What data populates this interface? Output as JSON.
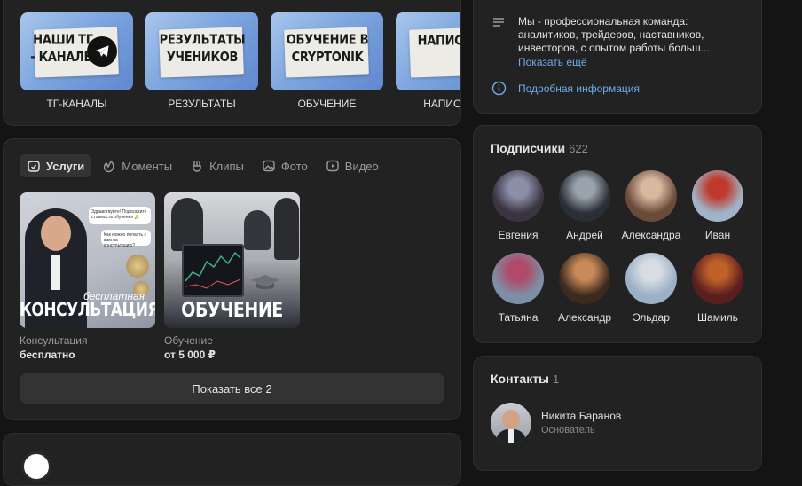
{
  "albums": [
    {
      "cover_text": "НАШИ ТГ - КАНАЛЫ",
      "caption": "ТГ-КАНАЛЫ",
      "has_tg_icon": true
    },
    {
      "cover_text": "РЕЗУЛЬТАТЫ УЧЕНИКОВ",
      "caption": "РЕЗУЛЬТАТЫ",
      "has_tg_icon": false
    },
    {
      "cover_text": "ОБУЧЕНИЕ В CRYPTONIK",
      "caption": "ОБУЧЕНИЕ",
      "has_tg_icon": false
    },
    {
      "cover_text": "НАПИСАТЬ",
      "caption": "НАПИСАТЬ",
      "has_tg_icon": false
    }
  ],
  "tabs": [
    {
      "label": "Услуги",
      "icon": "services-icon",
      "active": true
    },
    {
      "label": "Моменты",
      "icon": "moments-icon",
      "active": false
    },
    {
      "label": "Клипы",
      "icon": "clips-icon",
      "active": false
    },
    {
      "label": "Фото",
      "icon": "photo-icon",
      "active": false
    },
    {
      "label": "Видео",
      "icon": "video-icon",
      "active": false
    }
  ],
  "services": [
    {
      "title": "Консультация",
      "price": "бесплатно",
      "cover_script": "бесплатная",
      "cover_big": "КОНСУЛЬТАЦИЯ",
      "bubble1": "Здравствуйте! Подскажите стоимость обучения 🙏",
      "bubble2": "Как можно попасть к вам на консультацию?"
    },
    {
      "title": "Обучение",
      "price": "от 5 000 ₽",
      "cover_big": "ОБУЧЕНИЕ"
    }
  ],
  "show_all_label": "Показать все 2",
  "about": {
    "text": "Мы - профессиональная команда: аналитиков, трейдеров, наставников, инвесторов, с опытом работы больш...",
    "show_more": "Показать ещё",
    "details": "Подробная информация"
  },
  "subscribers": {
    "title": "Подписчики",
    "count": "622",
    "items": [
      {
        "name": "Евгения",
        "colors": [
          "#3a3340",
          "#8b8fa8"
        ]
      },
      {
        "name": "Андрей",
        "colors": [
          "#2a2e35",
          "#9aa3ad"
        ]
      },
      {
        "name": "Александра",
        "colors": [
          "#6b4a3a",
          "#d9b8a0"
        ]
      },
      {
        "name": "Иван",
        "colors": [
          "#9fb4c8",
          "#c0392b"
        ]
      },
      {
        "name": "Татьяна",
        "colors": [
          "#7c8fa6",
          "#b04a6a"
        ]
      },
      {
        "name": "Александр",
        "colors": [
          "#3b2a1e",
          "#c98a5a"
        ]
      },
      {
        "name": "Эльдар",
        "colors": [
          "#9bb0c6",
          "#d8dde3"
        ]
      },
      {
        "name": "Шамиль",
        "colors": [
          "#5a1e1e",
          "#c0602a"
        ]
      }
    ]
  },
  "contacts": {
    "title": "Контакты",
    "count": "1",
    "items": [
      {
        "name": "Никита Баранов",
        "role": "Основатель"
      }
    ]
  },
  "colors": {
    "accent": "#71aaeb",
    "card": "#222222",
    "bg": "#141414"
  }
}
